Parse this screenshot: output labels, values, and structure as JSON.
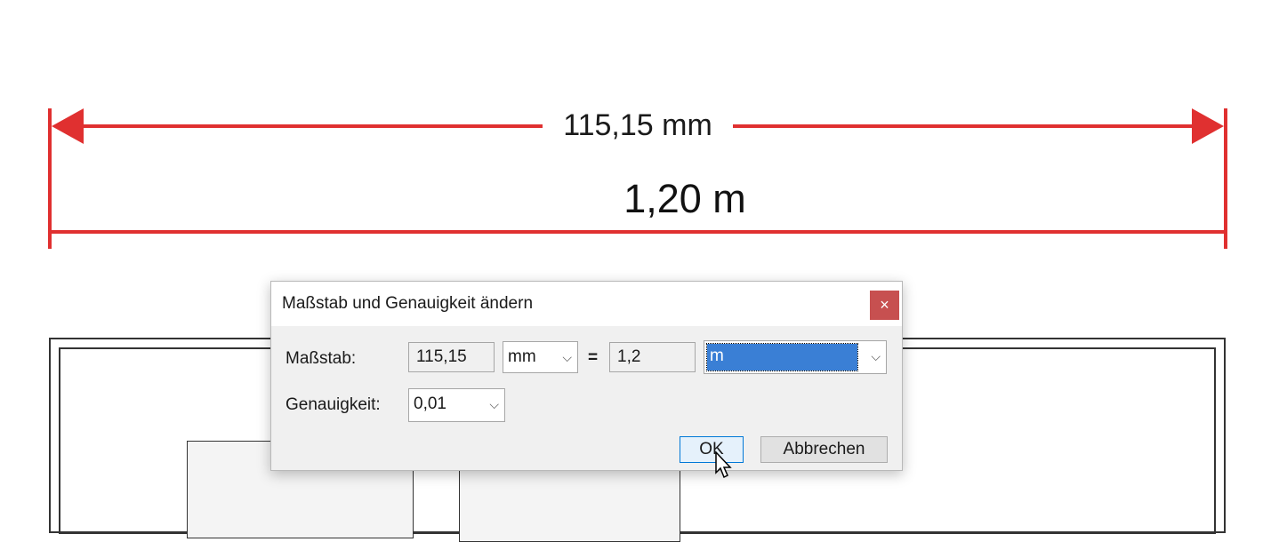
{
  "measurement": {
    "scaled_value": "115,15 mm",
    "real_value": "1,20 m",
    "line_color": "#e03030"
  },
  "dialog": {
    "title": "Maßstab und Genauigkeit ändern",
    "close_glyph": "×",
    "scale_label": "Maßstab:",
    "scale_value": "115,15",
    "scale_unit": "mm",
    "equals": "=",
    "real_value": "1,2",
    "real_unit": "m",
    "precision_label": "Genauigkeit:",
    "precision_value": "0,01",
    "ok_label": "OK",
    "cancel_label": "Abbrechen",
    "chevron_glyph": "⌵"
  },
  "colors": {
    "accent": "#3a7fd5",
    "close": "#c75050"
  }
}
